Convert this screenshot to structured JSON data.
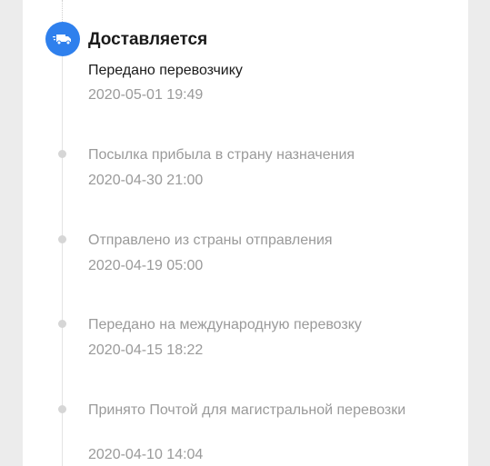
{
  "tracking": {
    "current": {
      "status_title": "Доставляется",
      "description": "Передано перевозчику",
      "timestamp": "2020-05-01 19:49",
      "icon": "truck-icon",
      "accent_color": "#2f80ed"
    },
    "events": [
      {
        "description": "Посылка прибыла в страну назначения",
        "timestamp": "2020-04-30 21:00"
      },
      {
        "description": "Отправлено из страны отправления",
        "timestamp": "2020-04-19 05:00"
      },
      {
        "description": "Передано на международную перевозку",
        "timestamp": "2020-04-15 18:22"
      },
      {
        "description": "Принято Почтой для магистральной перевозки",
        "timestamp": "2020-04-10 14:04"
      }
    ]
  }
}
